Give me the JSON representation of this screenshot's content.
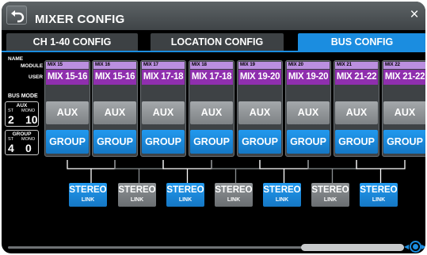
{
  "titlebar": {
    "title": "MIXER CONFIG",
    "close": "×"
  },
  "tabs": [
    {
      "label": "CH 1-40 CONFIG",
      "active": false
    },
    {
      "label": "LOCATION CONFIG",
      "active": false
    },
    {
      "label": "BUS CONFIG",
      "active": true
    }
  ],
  "row_labels": {
    "name": "NAME",
    "module": "MODULE",
    "user": "USER",
    "bus_mode": "BUS MODE"
  },
  "counters": {
    "aux": {
      "title": "AUX",
      "st_label": "ST",
      "mono_label": "MONO",
      "st": "2",
      "mono": "10"
    },
    "group": {
      "title": "GROUP",
      "st_label": "ST",
      "mono_label": "MONO",
      "st": "4",
      "mono": "0"
    }
  },
  "buses": [
    {
      "module": "MIX 15",
      "user": "MIX 15-16",
      "aux": "AUX",
      "group": "GROUP"
    },
    {
      "module": "MIX 16",
      "user": "MIX 15-16",
      "aux": "AUX",
      "group": "GROUP"
    },
    {
      "module": "MIX 17",
      "user": "MIX 17-18",
      "aux": "AUX",
      "group": "GROUP"
    },
    {
      "module": "MIX 18",
      "user": "MIX 17-18",
      "aux": "AUX",
      "group": "GROUP"
    },
    {
      "module": "MIX 19",
      "user": "MIX 19-20",
      "aux": "AUX",
      "group": "GROUP"
    },
    {
      "module": "MIX 20",
      "user": "MIX 19-20",
      "aux": "AUX",
      "group": "GROUP"
    },
    {
      "module": "MIX 21",
      "user": "MIX 21-22",
      "aux": "AUX",
      "group": "GROUP"
    },
    {
      "module": "MIX 22",
      "user": "MIX 21-22",
      "aux": "AUX",
      "group": "GROUP"
    }
  ],
  "stereo_links": [
    {
      "label": "STEREO",
      "sub": "LINK",
      "on": true
    },
    {
      "label": "STEREO",
      "sub": "LINK",
      "on": false
    },
    {
      "label": "STEREO",
      "sub": "LINK",
      "on": true
    },
    {
      "label": "STEREO",
      "sub": "LINK",
      "on": false
    },
    {
      "label": "STEREO",
      "sub": "LINK",
      "on": true
    },
    {
      "label": "STEREO",
      "sub": "LINK",
      "on": false
    },
    {
      "label": "STEREO",
      "sub": "LINK",
      "on": true
    }
  ],
  "colors": {
    "accent": "#1b8de0",
    "module_label": "#bb8fe0",
    "user_label": "#8f2fae",
    "aux": "#8f9396"
  }
}
